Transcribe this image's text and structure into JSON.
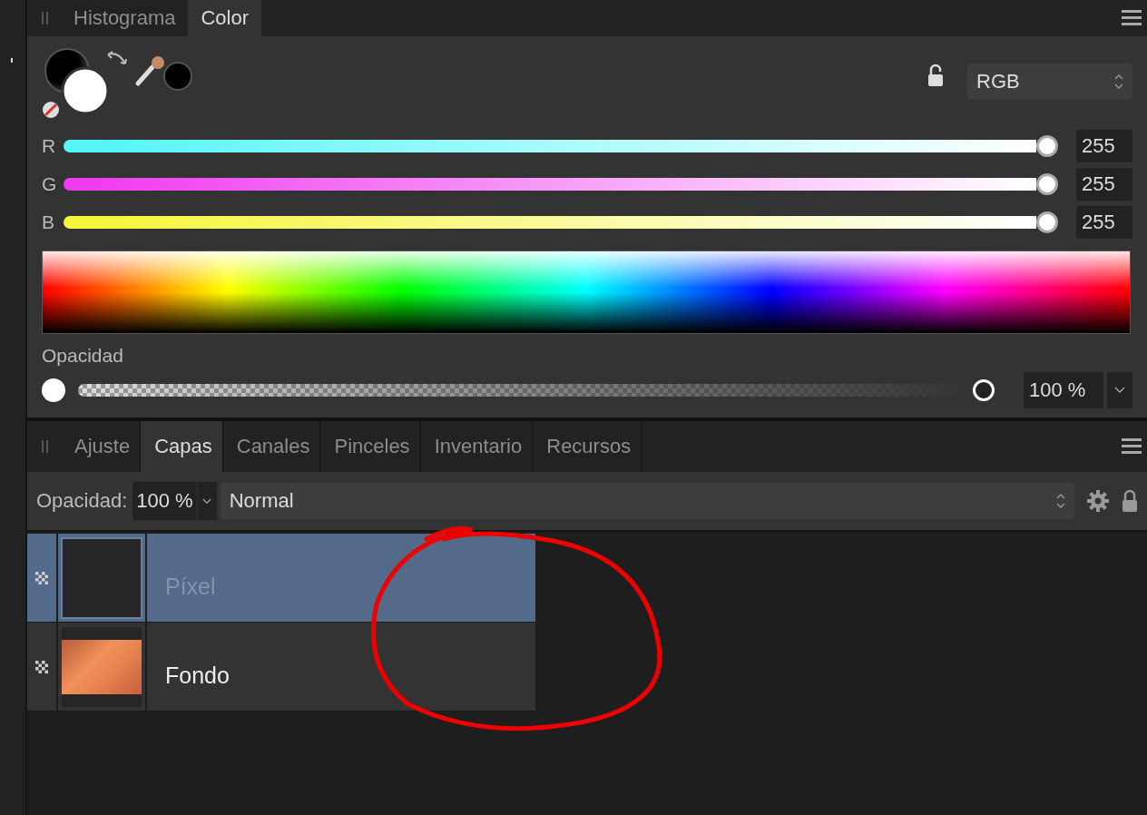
{
  "top_panel": {
    "tabs": [
      {
        "label": "Histograma",
        "selected": false
      },
      {
        "label": "Color",
        "selected": true
      }
    ]
  },
  "color": {
    "model": "RGB",
    "sliders": [
      {
        "name": "R",
        "level": 1,
        "value": "255",
        "color": "#55f5f8"
      },
      {
        "name": "G",
        "level": 1,
        "value": "255",
        "color": "#f03cf0"
      },
      {
        "name": "B",
        "level": 1,
        "value": "255",
        "color": "#f5f53c"
      }
    ],
    "opacity": {
      "label": "Opacidad",
      "level": 1,
      "value": "100 %"
    }
  },
  "bottom_panel": {
    "tabs": [
      {
        "label": "Ajuste",
        "selected": false
      },
      {
        "label": "Capas",
        "selected": true
      },
      {
        "label": "Canales",
        "selected": false
      },
      {
        "label": "Pinceles",
        "selected": false
      },
      {
        "label": "Inventario",
        "selected": false
      },
      {
        "label": "Recursos",
        "selected": false
      }
    ]
  },
  "layers_toolbar": {
    "opacity_label": "Opacidad:",
    "opacity_value": "100 %",
    "blend_mode": "Normal"
  },
  "layers": [
    {
      "name": "Píxel",
      "selected": true,
      "hidden": true,
      "kind": "empty"
    },
    {
      "name": "Fondo",
      "selected": false,
      "hidden": false,
      "kind": "photo"
    }
  ]
}
